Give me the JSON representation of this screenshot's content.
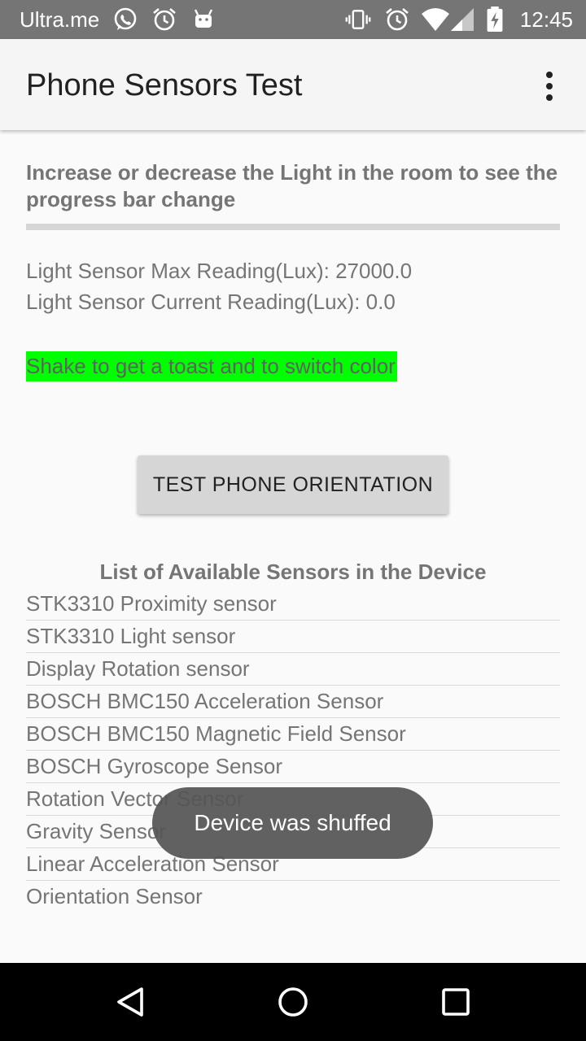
{
  "status_bar": {
    "carrier": "Ultra.me",
    "time": "12:45",
    "icons": [
      "whatsapp-icon",
      "alarm-icon",
      "android-icon",
      "vibrate-icon",
      "alarm-icon",
      "wifi-icon",
      "signal-icon",
      "battery-icon"
    ],
    "background": "#757575"
  },
  "app_bar": {
    "title": "Phone Sensors Test",
    "menu_icon": "more-vert-icon"
  },
  "light": {
    "instruction": "Increase or decrease the Light in the room to see the progress bar change",
    "progress": 0,
    "max_reading": "Light Sensor Max Reading(Lux): 27000.0",
    "current_reading": "Light Sensor Current Reading(Lux): 0.0"
  },
  "shake": {
    "label": "Shake to get a toast and to switch color",
    "highlight_color": "#00ff00"
  },
  "orientation_button": {
    "label": "TEST PHONE ORIENTATION"
  },
  "sensors": {
    "title": "List of Available Sensors in the Device",
    "items": [
      "STK3310 Proximity sensor",
      "STK3310 Light sensor",
      "Display Rotation sensor",
      "BOSCH BMC150 Acceleration Sensor",
      "BOSCH BMC150 Magnetic Field Sensor",
      "BOSCH Gyroscope Sensor",
      "Rotation Vector Sensor",
      "Gravity Sensor",
      "Linear Acceleration Sensor",
      "Orientation Sensor"
    ]
  },
  "toast": {
    "message": "Device was shuffed"
  },
  "nav_bar": {
    "icons": [
      "back-icon",
      "home-icon",
      "recents-icon"
    ]
  }
}
